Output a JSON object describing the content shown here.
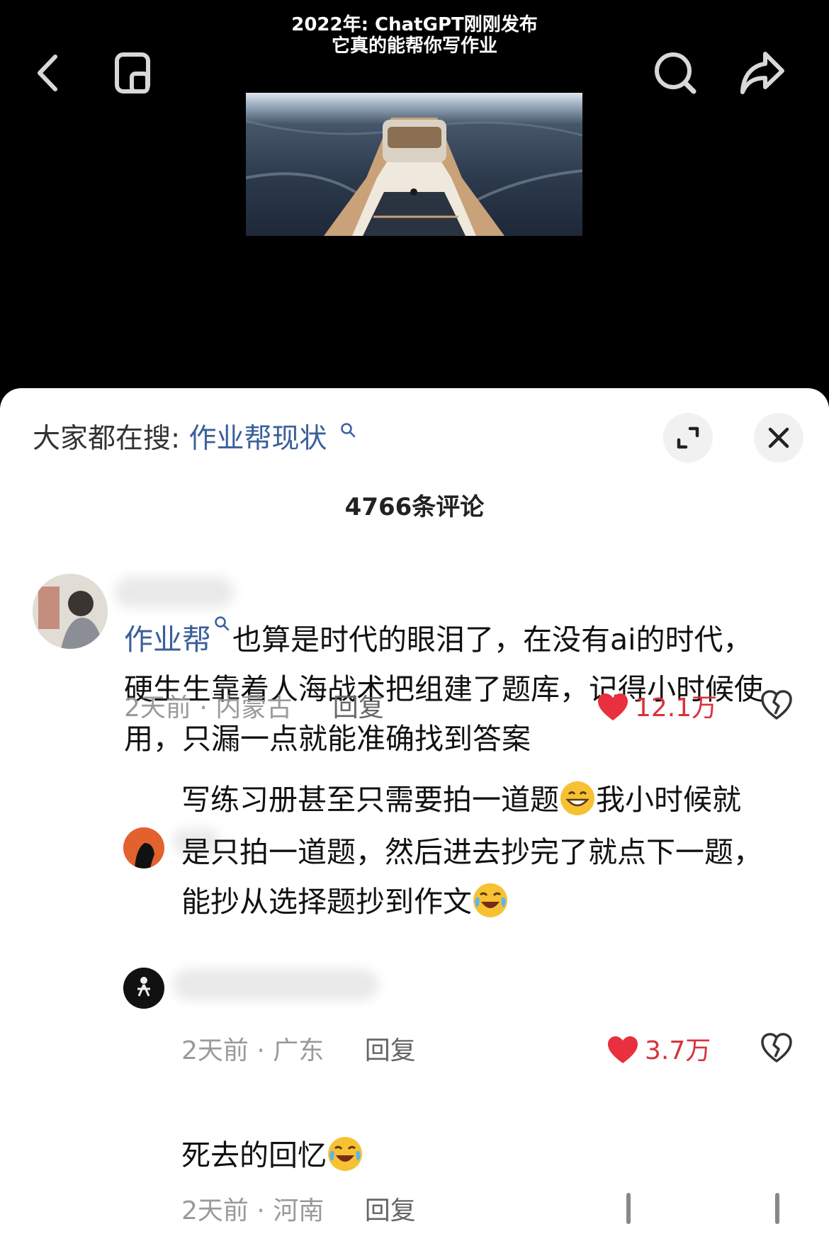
{
  "video": {
    "caption_line1": "2022年: ChatGPT刚刚发布",
    "caption_line2": "它真的能帮你写作业",
    "back_icon": "chevron-left-icon",
    "mini_icon": "mini-window-icon",
    "search_icon": "search-icon",
    "share_icon": "share-icon"
  },
  "comments_panel": {
    "search_prefix": "大家都在搜:",
    "search_keyword": "作业帮现状",
    "count_label": "4766条评论",
    "expand_icon": "expand-icon",
    "close_icon": "close-icon",
    "comments": [
      {
        "keyword": "作业帮",
        "line1_rest": "也算是时代的眼泪了，在没有ai的时代，",
        "line2": "硬生生靠着人海战术把组建了题库，记得小时候使",
        "line3": "用，只漏一点就能准确找到答案",
        "time": "2天前",
        "location": "内蒙古",
        "reply": "回复",
        "likes": "12.1万"
      },
      {
        "line1": "写练习册甚至只需要拍一道题",
        "line1_after_emoji": "我小时候就",
        "line2": "是只拍一道题，然后进去抄完了就点下一题，",
        "line3": "能抄从选择题抄到作文",
        "time": "2天前",
        "location": "广东",
        "reply": "回复",
        "likes": "3.7万"
      },
      {
        "line1": "死去的回忆",
        "time": "2天前",
        "location": "河南",
        "reply": "回复"
      }
    ],
    "separator": " · "
  }
}
